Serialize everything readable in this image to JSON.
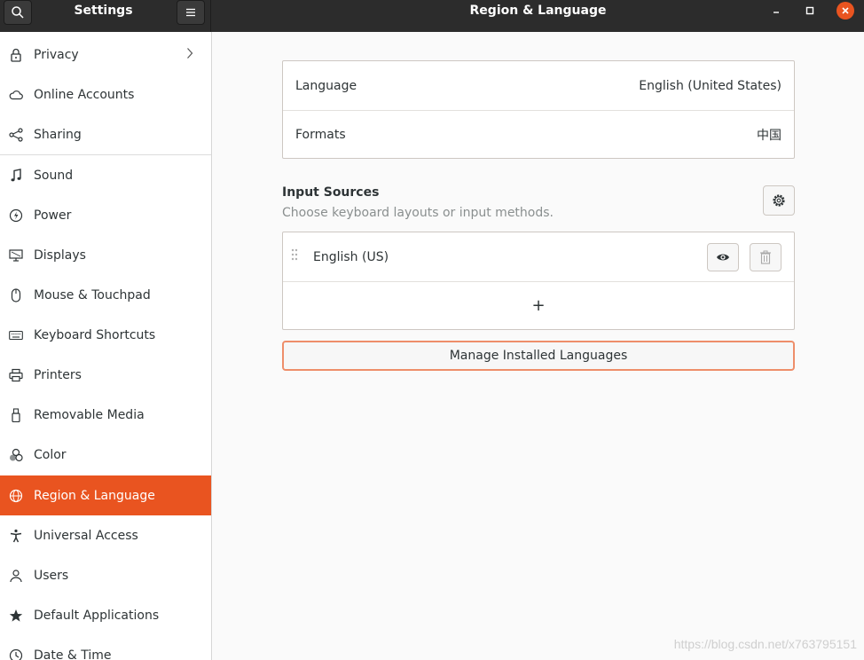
{
  "header": {
    "sidebar_title": "Settings",
    "title": "Region & Language",
    "icons": {
      "search": "search-icon",
      "menu": "hamburger-menu-icon",
      "minimize": "minimize-icon",
      "maximize": "maximize-icon",
      "close": "close-icon"
    }
  },
  "sidebar": {
    "items": [
      {
        "label": "Privacy",
        "icon": "lock-icon"
      },
      {
        "label": "Online Accounts",
        "icon": "cloud-icon"
      },
      {
        "label": "Sharing",
        "icon": "share-icon"
      },
      {
        "label": "Sound",
        "icon": "music-note-icon"
      },
      {
        "label": "Power",
        "icon": "power-icon"
      },
      {
        "label": "Displays",
        "icon": "display-icon"
      },
      {
        "label": "Mouse & Touchpad",
        "icon": "mouse-icon"
      },
      {
        "label": "Keyboard Shortcuts",
        "icon": "keyboard-icon"
      },
      {
        "label": "Printers",
        "icon": "printer-icon"
      },
      {
        "label": "Removable Media",
        "icon": "usb-icon"
      },
      {
        "label": "Color",
        "icon": "color-icon"
      },
      {
        "label": "Region & Language",
        "icon": "globe-icon",
        "active": true
      },
      {
        "label": "Universal Access",
        "icon": "accessibility-icon"
      },
      {
        "label": "Users",
        "icon": "users-icon"
      },
      {
        "label": "Default Applications",
        "icon": "star-icon"
      },
      {
        "label": "Date & Time",
        "icon": "clock-icon"
      }
    ]
  },
  "main": {
    "language_row": {
      "label": "Language",
      "value": "English (United States)"
    },
    "formats_row": {
      "label": "Formats",
      "value": "中国"
    },
    "input_sources": {
      "title": "Input Sources",
      "subtitle": "Choose keyboard layouts or input methods.",
      "items": [
        {
          "label": "English (US)"
        }
      ],
      "add_label": "+"
    },
    "manage_button": "Manage Installed Languages"
  },
  "watermark": "https://blog.csdn.net/x763795151",
  "colors": {
    "accent": "#e95420",
    "headerbar": "#2c2c2c",
    "sidebar_bg": "#ffffff",
    "content_bg": "#fafafa"
  }
}
